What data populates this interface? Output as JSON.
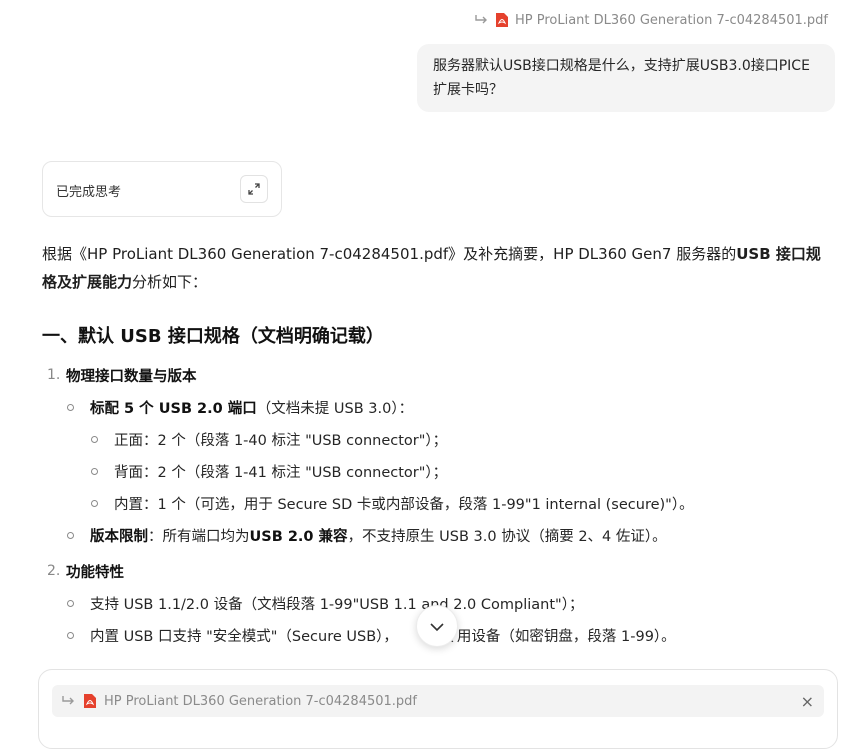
{
  "quoted_file": {
    "name": "HP ProLiant DL360 Generation 7-c04284501.pdf",
    "icon": "pdf-icon"
  },
  "user_message": "服务器默认USB接口规格是什么，支持扩展USB3.0接口PICE扩展卡吗？",
  "thinking": {
    "label": "已完成思考",
    "icon": "expand-icon"
  },
  "answer": {
    "intro_a": "根据《HP ProLiant DL360 Generation 7-c04284501.pdf》及补充摘要，HP DL360 Gen7 服务器的",
    "intro_b": "USB 接口规格及扩展能力",
    "intro_c": "分析如下：",
    "section1_title": "一、默认 USB 接口规格（文档明确记载）",
    "item1_num": "1.",
    "item1_title": "物理接口数量与版本",
    "item1_sub1_bold": "标配 5 个 USB 2.0 端口",
    "item1_sub1_rest": "（文档未提 USB 3.0）：",
    "item1_sub1_a": "正面：2 个（段落 1-40 标注 \"USB connector\"）；",
    "item1_sub1_b": "背面：2 个（段落 1-41 标注 \"USB connector\"）；",
    "item1_sub1_c": "内置：1 个（可选，用于 Secure SD 卡或内部设备，段落 1-99\"1 internal (secure)\"）。",
    "item1_sub2_bold": "版本限制",
    "item1_sub2_mid": "：所有端口均为",
    "item1_sub2_bold2": "USB 2.0 兼容",
    "item1_sub2_rest": "，不支持原生 USB 3.0 协议（摘要 2、4 佐证）。",
    "item2_num": "2.",
    "item2_title": "功能特性",
    "item2_sub1": "支持 USB 1.1/2.0 设备（文档段落 1-99\"USB 1.1 and 2.0 Compliant\"）；",
    "item2_sub2_a": "内置 USB 口支持 \"安全模式\"（Secure USB），",
    "item2_sub2_b": "定专用设备（如密钥盘，段落 1-99）。"
  },
  "composer": {
    "attachment": "HP ProLiant DL360 Generation 7-c04284501.pdf",
    "close_symbol": "×"
  }
}
